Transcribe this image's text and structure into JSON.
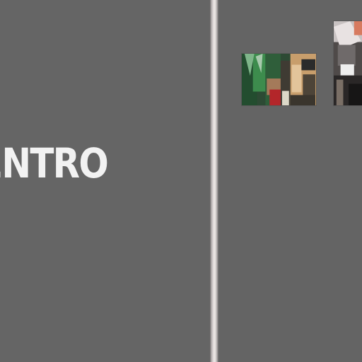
{
  "left_panel": {
    "title": "ENTRO"
  },
  "colors": {
    "background": "#646464",
    "divider": "#e6e1df",
    "title_text": "#f2f2f2"
  },
  "gallery": {
    "thumbnails": [
      {
        "name": "painting-thumbnail-1"
      },
      {
        "name": "painting-thumbnail-2"
      }
    ]
  }
}
